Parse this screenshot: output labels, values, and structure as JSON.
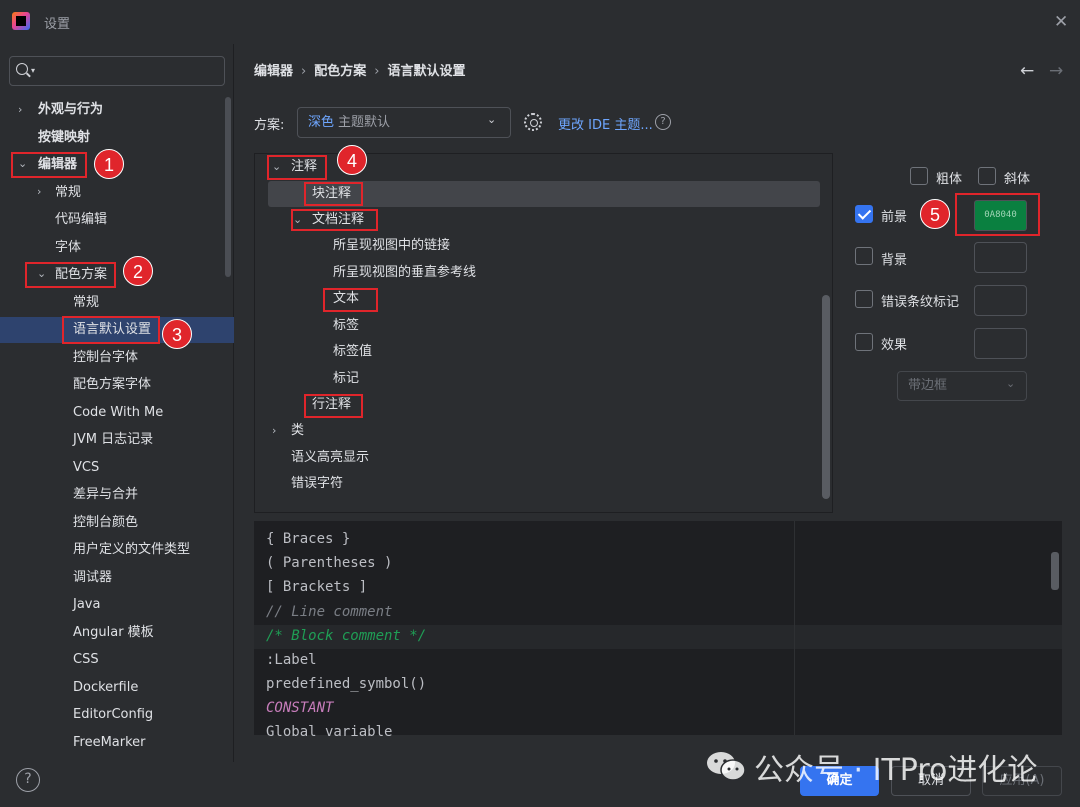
{
  "window": {
    "title": "设置",
    "close_glyph": "✕"
  },
  "search": {
    "placeholder": "",
    "caret": "▾"
  },
  "sidebar": {
    "items": [
      {
        "label": "外观与行为",
        "chev": "›"
      },
      {
        "label": "按键映射"
      },
      {
        "label": "编辑器",
        "chev": "⌄"
      },
      {
        "label": "常规",
        "chev": "›"
      },
      {
        "label": "代码编辑"
      },
      {
        "label": "字体"
      },
      {
        "label": "配色方案",
        "chev": "⌄"
      },
      {
        "label": "常规"
      },
      {
        "label": "语言默认设置"
      },
      {
        "label": "控制台字体"
      },
      {
        "label": "配色方案字体"
      },
      {
        "label": "Code With Me"
      },
      {
        "label": "JVM 日志记录"
      },
      {
        "label": "VCS"
      },
      {
        "label": "差异与合并"
      },
      {
        "label": "控制台颜色"
      },
      {
        "label": "用户定义的文件类型"
      },
      {
        "label": "调试器"
      },
      {
        "label": "Java"
      },
      {
        "label": "Angular 模板"
      },
      {
        "label": "CSS"
      },
      {
        "label": "Dockerfile"
      },
      {
        "label": "EditorConfig"
      },
      {
        "label": "FreeMarker"
      }
    ]
  },
  "annotations": {
    "b1": "1",
    "b2": "2",
    "b3": "3",
    "b4": "4",
    "b5": "5"
  },
  "breadcrumb": {
    "a": "编辑器",
    "b": "配色方案",
    "c": "语言默认设置",
    "sep": "›"
  },
  "nav": {
    "back": "←",
    "forward": "→"
  },
  "scheme": {
    "label": "方案:",
    "value": "深色",
    "hint": "主题默认",
    "chev": "⌄",
    "link": "更改 IDE 主题...",
    "help": "?"
  },
  "tree": {
    "items": [
      {
        "label": "注释",
        "chev": "⌄"
      },
      {
        "label": "块注释"
      },
      {
        "label": "文档注释",
        "chev": "⌄"
      },
      {
        "label": "所呈现视图中的链接"
      },
      {
        "label": "所呈现视图的垂直参考线"
      },
      {
        "label": "文本"
      },
      {
        "label": "标签"
      },
      {
        "label": "标签值"
      },
      {
        "label": "标记"
      },
      {
        "label": "行注释"
      },
      {
        "label": "类",
        "chev": "›"
      },
      {
        "label": "语义高亮显示"
      },
      {
        "label": "错误字符"
      }
    ]
  },
  "attributes": {
    "bold": "粗体",
    "italic": "斜体",
    "foreground": "前景",
    "foreground_color": "0A8040",
    "foreground_color_hex": "#0a8040",
    "background": "背景",
    "error_stripe": "错误条纹标记",
    "effects": "效果",
    "effect_type": "带边框",
    "effect_chev": "⌄"
  },
  "preview": {
    "lines": [
      "{ Braces }",
      "( Parentheses )",
      "[ Brackets ]",
      "// Line comment",
      "/* Block comment */",
      ":Label",
      "predefined_symbol()",
      "CONSTANT",
      "Global variable"
    ]
  },
  "footer": {
    "help": "?",
    "ok": "确定",
    "cancel": "取消",
    "apply": "应用(A)"
  },
  "watermark": {
    "text": "公众号 · ITPro进化论"
  }
}
